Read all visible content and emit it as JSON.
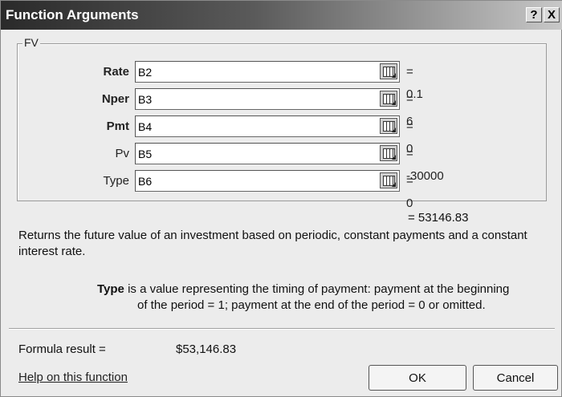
{
  "window": {
    "title": "Function Arguments",
    "help_label": "?",
    "close_label": "X"
  },
  "function": {
    "name": "FV",
    "arguments": [
      {
        "label": "Rate",
        "value": "B2",
        "result": "= 0.1"
      },
      {
        "label": "Nper",
        "value": "B3",
        "result": "= 6"
      },
      {
        "label": "Pmt",
        "value": "B4",
        "result": "= 0"
      },
      {
        "label": "Pv",
        "value": "B5",
        "result": "= -30000"
      },
      {
        "label": "Type",
        "value": "B6",
        "result": "= 0"
      }
    ],
    "result": "= 53146.83",
    "description": "Returns the future value of an investment based on periodic, constant payments and a constant interest rate.",
    "arg_help_name": "Type",
    "arg_help_line1": "is a value representing the timing of payment: payment at the beginning",
    "arg_help_line2": "of the period = 1; payment at the end of the period = 0 or omitted."
  },
  "footer": {
    "formula_result_label": "Formula result =",
    "formula_result_value": "$53,146.83",
    "help_link": "Help on this function",
    "ok_label": "OK",
    "cancel_label": "Cancel"
  }
}
